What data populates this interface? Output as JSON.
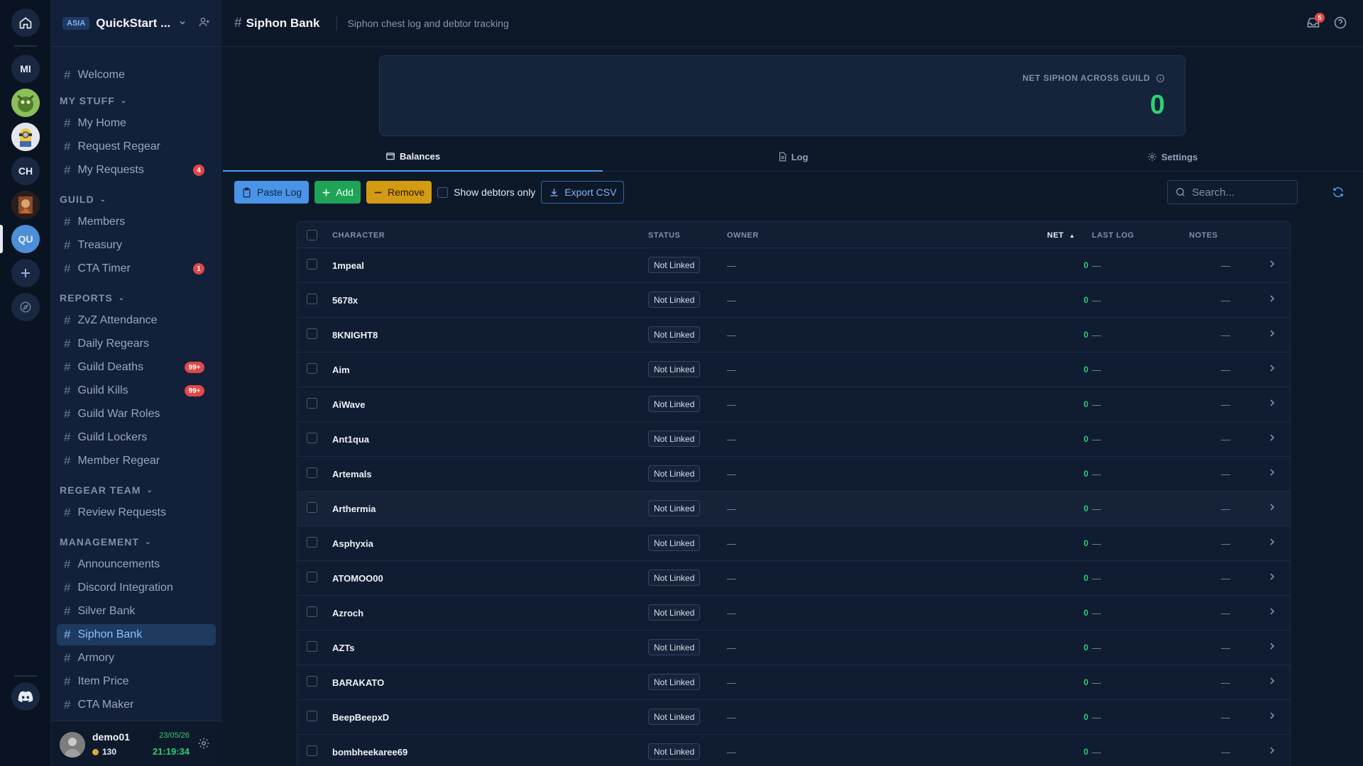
{
  "rail": {
    "servers": [
      {
        "label": "MI"
      },
      {
        "label": "CH"
      },
      {
        "label": "QU"
      }
    ]
  },
  "sidebar": {
    "region": "ASIA",
    "guild_name": "QuickStart ...",
    "top_items": [
      {
        "label": "Welcome"
      }
    ],
    "sections": [
      {
        "title": "MY STUFF",
        "items": [
          {
            "label": "My Home"
          },
          {
            "label": "Request Regear"
          },
          {
            "label": "My Requests",
            "badge": "4"
          }
        ]
      },
      {
        "title": "GUILD",
        "items": [
          {
            "label": "Members"
          },
          {
            "label": "Treasury"
          },
          {
            "label": "CTA Timer",
            "badge": "1"
          }
        ]
      },
      {
        "title": "REPORTS",
        "items": [
          {
            "label": "ZvZ Attendance"
          },
          {
            "label": "Daily Regears"
          },
          {
            "label": "Guild Deaths",
            "badge": "99+"
          },
          {
            "label": "Guild Kills",
            "badge": "99+"
          },
          {
            "label": "Guild War Roles"
          },
          {
            "label": "Guild Lockers"
          },
          {
            "label": "Member Regear"
          }
        ]
      },
      {
        "title": "REGEAR TEAM",
        "items": [
          {
            "label": "Review Requests"
          }
        ]
      },
      {
        "title": "MANAGEMENT",
        "items": [
          {
            "label": "Announcements"
          },
          {
            "label": "Discord Integration"
          },
          {
            "label": "Silver Bank"
          },
          {
            "label": "Siphon Bank",
            "active": true
          },
          {
            "label": "Armory"
          },
          {
            "label": "Item Price"
          },
          {
            "label": "CTA Maker"
          }
        ]
      }
    ]
  },
  "user": {
    "name": "demo01",
    "coins": "130",
    "date": "23/05/26",
    "time": "21:19:34"
  },
  "header": {
    "title": "Siphon Bank",
    "description": "Siphon chest log and debtor tracking",
    "notification_count": "5"
  },
  "summary": {
    "label": "NET SIPHON ACROSS GUILD",
    "value": "0"
  },
  "tabs": [
    {
      "label": "Balances",
      "active": true
    },
    {
      "label": "Log"
    },
    {
      "label": "Settings"
    }
  ],
  "toolbar": {
    "paste_label": "Paste Log",
    "add_label": "Add",
    "remove_label": "Remove",
    "debtors_label": "Show debtors only",
    "export_label": "Export CSV",
    "search_placeholder": "Search..."
  },
  "table": {
    "columns": {
      "character": "CHARACTER",
      "status": "STATUS",
      "owner": "OWNER",
      "net": "NET",
      "last_log": "LAST LOG",
      "notes": "NOTES"
    },
    "rows": [
      {
        "character": "1mpeal",
        "status": "Not Linked",
        "owner": "—",
        "net": "0",
        "last_log": "—",
        "notes": "—"
      },
      {
        "character": "5678x",
        "status": "Not Linked",
        "owner": "—",
        "net": "0",
        "last_log": "—",
        "notes": "—"
      },
      {
        "character": "8KNIGHT8",
        "status": "Not Linked",
        "owner": "—",
        "net": "0",
        "last_log": "—",
        "notes": "—"
      },
      {
        "character": "Aim",
        "status": "Not Linked",
        "owner": "—",
        "net": "0",
        "last_log": "—",
        "notes": "—"
      },
      {
        "character": "AiWave",
        "status": "Not Linked",
        "owner": "—",
        "net": "0",
        "last_log": "—",
        "notes": "—"
      },
      {
        "character": "Ant1qua",
        "status": "Not Linked",
        "owner": "—",
        "net": "0",
        "last_log": "—",
        "notes": "—"
      },
      {
        "character": "Artemals",
        "status": "Not Linked",
        "owner": "—",
        "net": "0",
        "last_log": "—",
        "notes": "—"
      },
      {
        "character": "Arthermia",
        "status": "Not Linked",
        "owner": "—",
        "net": "0",
        "last_log": "—",
        "notes": "—"
      },
      {
        "character": "Asphyxia",
        "status": "Not Linked",
        "owner": "—",
        "net": "0",
        "last_log": "—",
        "notes": "—"
      },
      {
        "character": "ATOMOO00",
        "status": "Not Linked",
        "owner": "—",
        "net": "0",
        "last_log": "—",
        "notes": "—"
      },
      {
        "character": "Azroch",
        "status": "Not Linked",
        "owner": "—",
        "net": "0",
        "last_log": "—",
        "notes": "—"
      },
      {
        "character": "AZTs",
        "status": "Not Linked",
        "owner": "—",
        "net": "0",
        "last_log": "—",
        "notes": "—"
      },
      {
        "character": "BARAKATO",
        "status": "Not Linked",
        "owner": "—",
        "net": "0",
        "last_log": "—",
        "notes": "—"
      },
      {
        "character": "BeepBeepxD",
        "status": "Not Linked",
        "owner": "—",
        "net": "0",
        "last_log": "—",
        "notes": "—"
      },
      {
        "character": "bombheekaree69",
        "status": "Not Linked",
        "owner": "—",
        "net": "0",
        "last_log": "—",
        "notes": "—"
      }
    ]
  }
}
